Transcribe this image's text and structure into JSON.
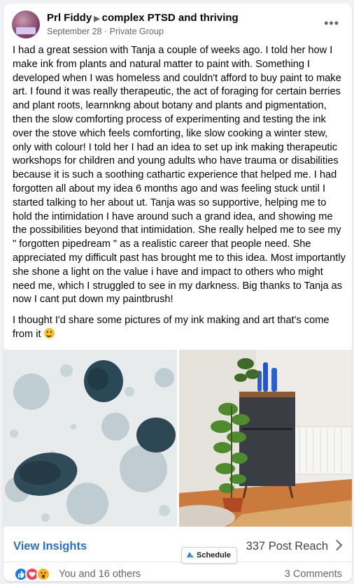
{
  "post": {
    "author": "Prl Fiddy",
    "group": "complex PTSD and thriving",
    "date": "September 28",
    "separator": "·",
    "privacy": "Private Group",
    "more_label": "•••",
    "paragraphs": [
      "I had a great session with Tanja a couple of weeks ago. I told her how I make ink from plants and natural matter to paint with. Something I developed when I was homeless and couldn't afford to buy paint to make art. I found it was really therapeutic, the act of foraging for certain berries and plant roots, learnnkng about botany and plants and pigmentation, then the slow comforting process of experimenting and testing the ink over the stove which feels comforting, like slow cooking a winter stew, only with colour! I told her I had an idea to set up ink making therapeutic workshops for children and young adults who have trauma or disabilities because it is such a soothing cathartic experience that helped me. I had forgotten all about my idea 6 months ago and was feeling stuck until I started talking to her about ut. Tanja was so supportive, helping me to hold the intimidation I have around such a grand idea, and showing me the possibilities beyond that intimidation. She really helped me to see my \" forgotten pipedream \" as a realistic career that people need. She appreciated my difficult past has brought me to this idea. Most importantly she shone a light on the value i have and impact to others who might need me, which I struggled to see in my darkness. Big thanks to Tanja as now I cant put down my paintbrush!",
      "I thought I'd share some pictures of my ink making and art that's come from it"
    ],
    "icons": {
      "avatar": "avatar-image",
      "arrow": "right-triangle-icon",
      "emoji": "smiley-emoji-icon"
    }
  },
  "insights": {
    "view_label": "View Insights",
    "reach_value": "337",
    "reach_label": "Post Reach",
    "schedule_label": "Schedule"
  },
  "engagement": {
    "reactions_text": "You and 16 others",
    "comments_text": "3 Comments",
    "reaction_types": [
      "like",
      "love",
      "wow"
    ]
  },
  "colors": {
    "link_blue": "#2d6fbf",
    "like_blue": "#1877f2",
    "love_red": "#f33e58",
    "wow_yellow": "#f7b125",
    "text_gray": "#65676b"
  }
}
